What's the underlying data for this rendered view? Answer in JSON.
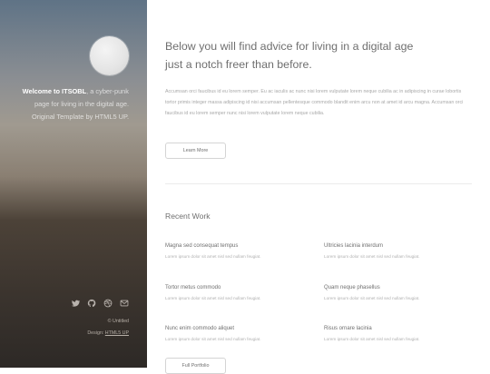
{
  "sidebar": {
    "intro_strong": "Welcome to ITSOBL",
    "intro_rest": ", a cyber-punk page for living in the digital age. Original Template by ",
    "intro_link": "HTML5 UP",
    "intro_end": ".",
    "credit_line1": "© Untitled",
    "credit_design_prefix": "Design: ",
    "credit_design_link": "HTML5 UP",
    "social_icons": [
      "twitter-icon",
      "github-icon",
      "dribbble-icon",
      "email-icon"
    ]
  },
  "main": {
    "headline_line1": "Below you will find advice for living in a digital age",
    "headline_line2": "just a notch freer than before.",
    "description": "Accumsan orci faucibus id eu lorem semper. Eu ac iaculis ac nunc nisi lorem vulputate lorem neque cubilia ac in adipiscing in curae lobortis tortor primis integer massa adipiscing id nisi accumsan pellentesque commodo blandit enim arcu non at amet id arcu magna. Accumsan orci faucibus id eu lorem semper nunc nisi lorem vulputate lorem neque cubilia.",
    "learn_more_label": "Learn More",
    "recent_work_title": "Recent Work",
    "works": [
      {
        "title": "Magna sed consequat tempus",
        "subtitle": "Lorem ipsum dolor sit amet nisl sed nullam feugiat."
      },
      {
        "title": "Ultricies lacinia interdum",
        "subtitle": "Lorem ipsum dolor sit amet nisl sed nullam feugiat."
      },
      {
        "title": "Tortor metus commodo",
        "subtitle": "Lorem ipsum dolor sit amet nisl sed nullam feugiat."
      },
      {
        "title": "Quam neque phasellus",
        "subtitle": "Lorem ipsum dolor sit amet nisl sed nullam feugiat."
      },
      {
        "title": "Nunc enim commodo aliquet",
        "subtitle": "Lorem ipsum dolor sit amet nisl sed nullam feugiat."
      },
      {
        "title": "Risus ornare lacinia",
        "subtitle": "Lorem ipsum dolor sit amet nisl sed nullam feugiat."
      }
    ],
    "full_portfolio_label": "Full Portfolio"
  }
}
